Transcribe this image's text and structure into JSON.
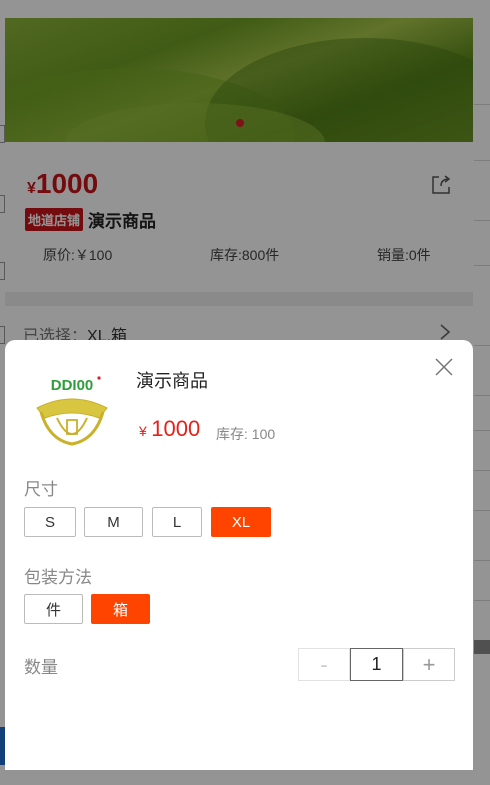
{
  "product": {
    "currency": "¥",
    "price": "1000",
    "tag": "地道店铺",
    "title": "演示商品",
    "original_price": "原价:￥100",
    "stock": "库存:800件",
    "sales": "销量:0件",
    "selected_label": "已选择：",
    "selected_value": "XL,箱"
  },
  "sheet": {
    "title": "演示商品",
    "currency": "¥",
    "price": "1000",
    "stock": "库存: 100",
    "logo_text": "DDI00",
    "size_label": "尺寸",
    "sizes": [
      {
        "label": "S",
        "active": false
      },
      {
        "label": "M",
        "active": false
      },
      {
        "label": "L",
        "active": false
      },
      {
        "label": "XL",
        "active": true
      }
    ],
    "pack_label": "包装方法",
    "packs": [
      {
        "label": "件",
        "active": false
      },
      {
        "label": "箱",
        "active": true
      }
    ],
    "qty_label": "数量",
    "qty_value": "1",
    "minus": "-",
    "plus": "+"
  },
  "colors": {
    "accent": "#ff4400",
    "price_red": "#e2231a",
    "logo_green": "#2f9e3a",
    "logo_red": "#d8202a",
    "logo_gold": "#c9b12a"
  }
}
